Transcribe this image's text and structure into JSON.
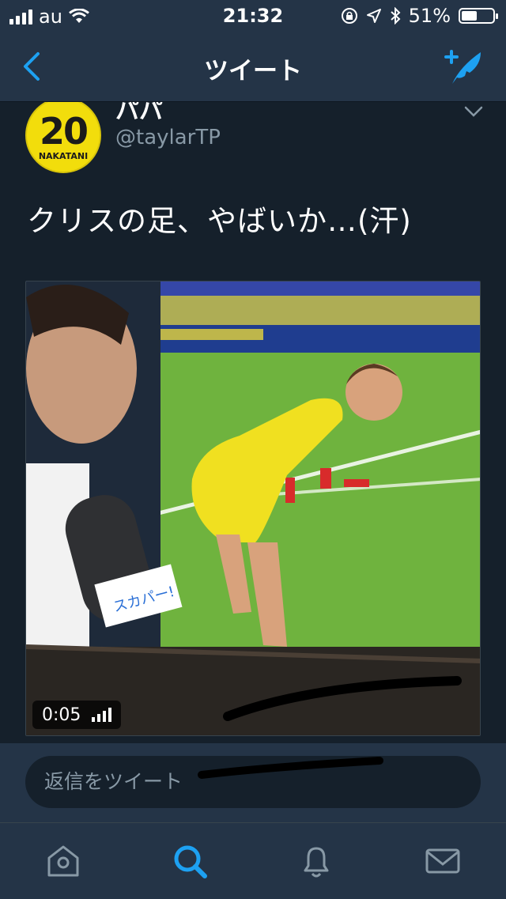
{
  "status_bar": {
    "carrier": "au",
    "time": "21:32",
    "battery": "51%",
    "battery_level": 0.51
  },
  "nav": {
    "title": "ツイート",
    "back_icon": "chevron-left-icon",
    "compose_icon": "compose-tweet-icon"
  },
  "tweet": {
    "display_name": "パパ",
    "handle": "@taylarTP",
    "avatar": {
      "number": "20",
      "name": "NAKATANI"
    },
    "text": "クリスの足、やばいか…(汗)",
    "media": {
      "type": "video",
      "duration": "0:05",
      "caption_tag": "スカパー!"
    }
  },
  "reply": {
    "placeholder": "返信をツイート"
  },
  "tab_bar": {
    "items": [
      {
        "name": "home",
        "icon": "home-icon"
      },
      {
        "name": "search",
        "icon": "search-icon",
        "active": true
      },
      {
        "name": "notifications",
        "icon": "bell-icon"
      },
      {
        "name": "messages",
        "icon": "mail-icon"
      }
    ]
  },
  "colors": {
    "background": "#15202b",
    "bar": "#243447",
    "accent": "#1da1f2",
    "secondary_text": "#8899a6"
  }
}
